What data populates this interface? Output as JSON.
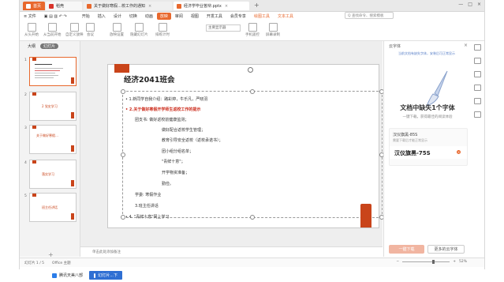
{
  "titlebar": {
    "tabs": [
      {
        "label": "首页",
        "bg": "#e8682d",
        "color": "#ffffff",
        "icon_color": "#ffffff"
      },
      {
        "label": "稻壳",
        "bg": "#f7f7f7",
        "color": "#333333",
        "icon_color": "#d8332a"
      },
      {
        "label": "关于做好寒假…校工作的通知",
        "bg": "#f0f0f0",
        "color": "#333333",
        "icon_color": "#e8682d"
      },
      {
        "label": "经济学毕业答辩.pptx",
        "bg": "#ffffff",
        "color": "#333333",
        "icon_color": "#e8682d"
      }
    ],
    "new_tab": "+"
  },
  "menubar": {
    "file": "≡ 文件",
    "items": [
      "开始",
      "插入",
      "设计",
      "切换",
      "动画",
      "放映",
      "审阅",
      "视图",
      "开发工具",
      "会员专享",
      "绘图工具",
      "文本工具"
    ],
    "active": "放映",
    "search_placeholder": "Q 查找命令、搜索模板"
  },
  "toolbar": {
    "items": [
      "从头开始",
      "从当前开始",
      "自定义放映",
      "会议",
      "放映设置",
      "隐藏幻灯片",
      "排练计时",
      "手机遥控",
      "屏幕录制"
    ],
    "screen_field": "主要显示器"
  },
  "slides_panel": {
    "tabs": [
      "大纲",
      "幻灯片"
    ],
    "active_tab": "幻灯片",
    "numbers": [
      "1",
      "2",
      "3",
      "4",
      "5"
    ],
    "thumb_titles": [
      "",
      "2 党史学习",
      "关于做好寒假…",
      "落实学习",
      "班主任讲话"
    ],
    "add_label": "+"
  },
  "slide": {
    "title": "经济2041班会",
    "lines": [
      {
        "text": "• 1.新同学自我介绍：路彩婷，牛乐凡，严晓羽",
        "red": false
      },
      {
        "text": "• 2.关于做好寒假开学师生返校工作的提示",
        "red": true
      },
      {
        "text": "团支书: 做好返校前健康监测；",
        "red": false
      },
      {
        "text": "做好配合返校学生管理；",
        "red": false
      },
      {
        "text": "教育引导安全返校（返校承诺书）；",
        "red": false
      },
      {
        "text": "团小组分组名单；",
        "red": false
      },
      {
        "text": "\"青鲜十意\"；",
        "red": false
      },
      {
        "text": "开学物资准备；",
        "red": false
      },
      {
        "text": "勤俭。",
        "red": false
      },
      {
        "text": "学委: 寒假作业",
        "red": false
      },
      {
        "text": "3.班主任讲话",
        "red": false
      },
      {
        "text": "• 4. \"青鲜十意\"网上学习",
        "red": false
      }
    ]
  },
  "notes": {
    "placeholder": "单击此处添加备注"
  },
  "font_panel": {
    "title": "云字体",
    "tip": "当前文档有缺失字体，安装后可正常显示",
    "heading": "文档中缺失1个字体",
    "subheading": "一键下载，获得最佳的阅读体验",
    "font_row1": "汉仪旗黑-85S",
    "font_row1_sub": "需要下载后才能正常显示",
    "font_row2": "汉仪旗黑-75S",
    "primary_button": "一键下载",
    "secondary_button": "更多的云字体"
  },
  "statusbar": {
    "slide_info": "幻灯片 1 / 5",
    "theme": "Office 主题",
    "zoom": "52%"
  },
  "taskbar": {
    "items": [
      "腾讯天美八部",
      "幻灯片...下"
    ]
  }
}
